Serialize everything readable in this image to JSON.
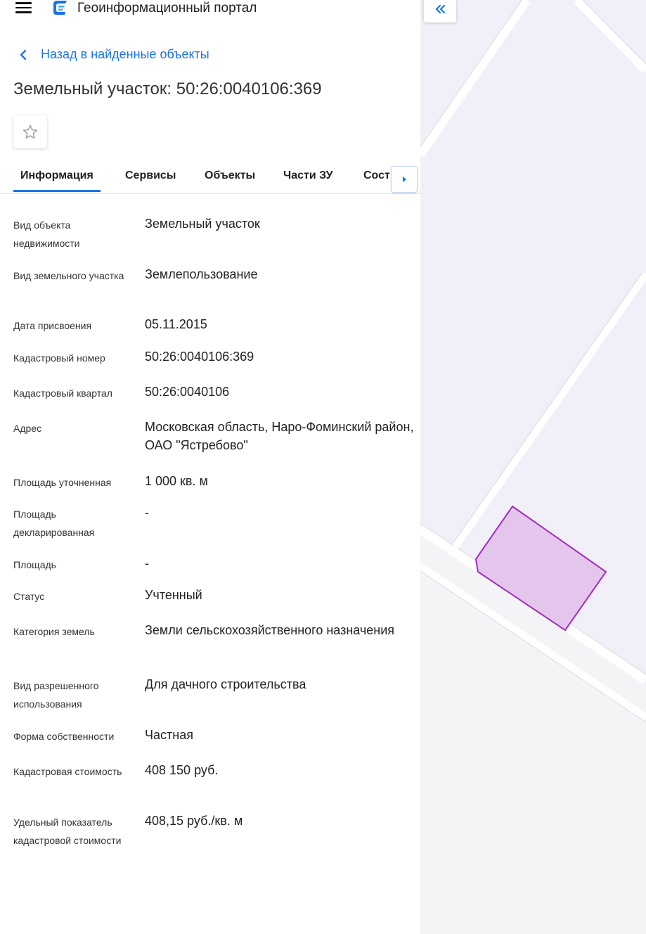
{
  "header": {
    "portal_title": "Геоинформационный портал"
  },
  "nav": {
    "back_label": "Назад в найденные объекты"
  },
  "page": {
    "title": "Земельный участок: 50:26:0040106:369"
  },
  "tabs": [
    {
      "label": "Информация",
      "active": true
    },
    {
      "label": "Сервисы"
    },
    {
      "label": "Объекты"
    },
    {
      "label": "Части ЗУ"
    },
    {
      "label": "Сост"
    }
  ],
  "rows": [
    {
      "label": "Вид объекта недвижимости",
      "value": "Земельный участок"
    },
    {
      "label": "Вид земельного участка",
      "value": "Землепользование"
    },
    {
      "label": "Дата присвоения",
      "value": "05.11.2015"
    },
    {
      "label": "Кадастровый номер",
      "value": "50:26:0040106:369"
    },
    {
      "label": "Кадастровый квартал",
      "value": "50:26:0040106"
    },
    {
      "label": "Адрес",
      "value": "Московская область, Наро-Фоминский район, ОАО \"Ястребово\""
    },
    {
      "label": "Площадь уточненная",
      "value": "1 000 кв. м"
    },
    {
      "label": "Площадь декларированная",
      "value": "-"
    },
    {
      "label": "Площадь",
      "value": "-"
    },
    {
      "label": "Статус",
      "value": "Учтенный"
    },
    {
      "label": "Категория земель",
      "value": "Земли сельскохозяйственного назначения"
    },
    {
      "label": "Вид разрешенного использования",
      "value": "Для дачного строительства"
    },
    {
      "label": "Форма собственности",
      "value": "Частная"
    },
    {
      "label": "Кадастровая стоимость",
      "value": "408 150 руб."
    },
    {
      "label": "Удельный показатель кадастровой стоимости",
      "value": "408,15 руб./кв. м"
    }
  ],
  "colors": {
    "accent": "#1a73e8",
    "parcel_fill": "#e4c6ec",
    "parcel_stroke": "#a22bc0",
    "map_background": "#f1f0f8"
  },
  "icons": {
    "menu": "menu-icon",
    "logo": "portal-logo-icon",
    "back": "chevron-left-icon",
    "favorite": "star-outline-icon",
    "tab_scroll": "caret-right-icon",
    "map_collapse": "double-chevron-left-icon"
  }
}
